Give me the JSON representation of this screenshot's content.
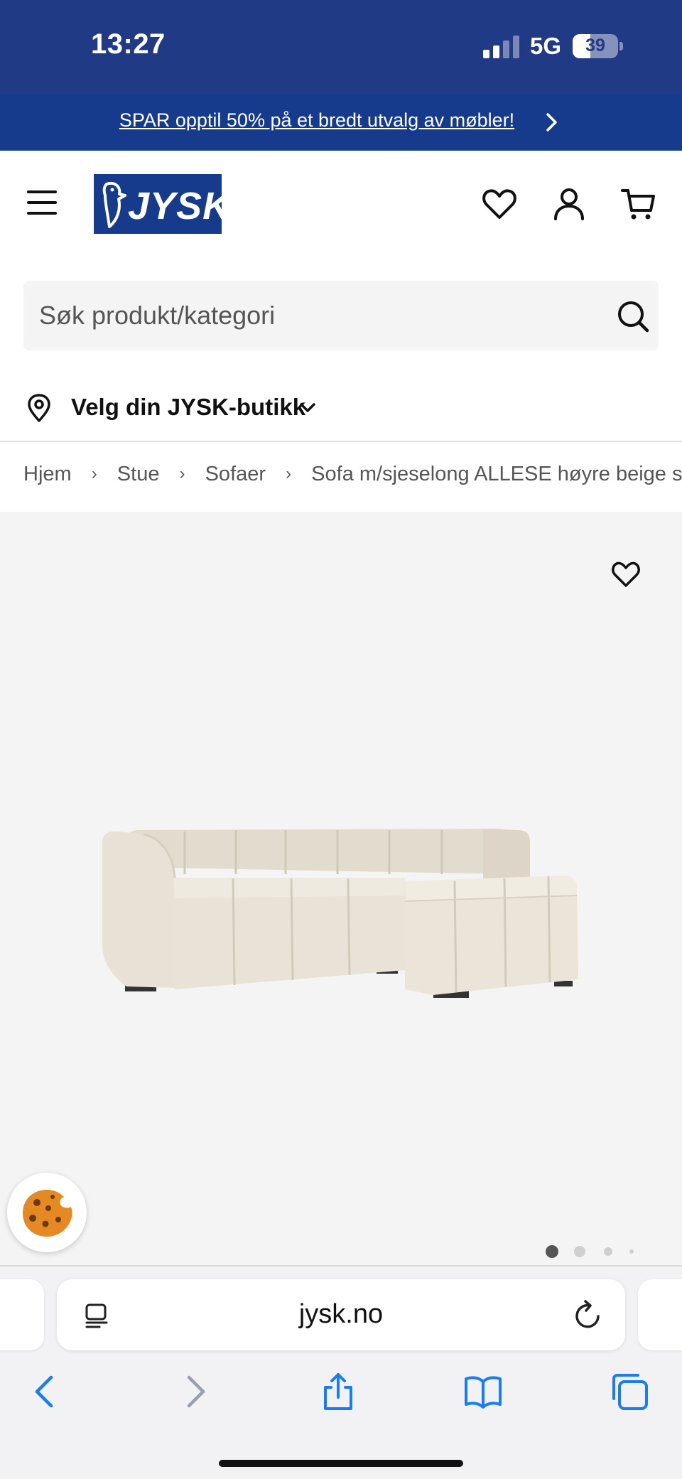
{
  "status_bar": {
    "time": "13:27",
    "network": "5G",
    "battery_level": "39",
    "battery_fraction": 0.39
  },
  "promo": {
    "text": "SPAR opptil 50% på et bredt utvalg av møbler!"
  },
  "header": {
    "logo_text": "JYSK",
    "icons": [
      "menu-icon",
      "heart-icon",
      "user-icon",
      "cart-icon"
    ]
  },
  "search": {
    "placeholder": "Søk produkt/kategori",
    "value": ""
  },
  "store_selector": {
    "label": "Velg din JYSK-butikk"
  },
  "breadcrumb": {
    "items": [
      "Hjem",
      "Stue",
      "Sofaer",
      "Sofa m/sjeselong ALLESE høyre beige stoff"
    ]
  },
  "gallery": {
    "image_count": 4,
    "active_index": 0
  },
  "safari": {
    "url": "jysk.no",
    "toolbar": [
      "back-icon",
      "forward-icon",
      "share-icon",
      "bookmarks-icon",
      "tabs-icon"
    ]
  },
  "colors": {
    "brand_blue": "#173b8c",
    "status_bar": "#213a86",
    "safari_blue": "#1a7cf5"
  }
}
